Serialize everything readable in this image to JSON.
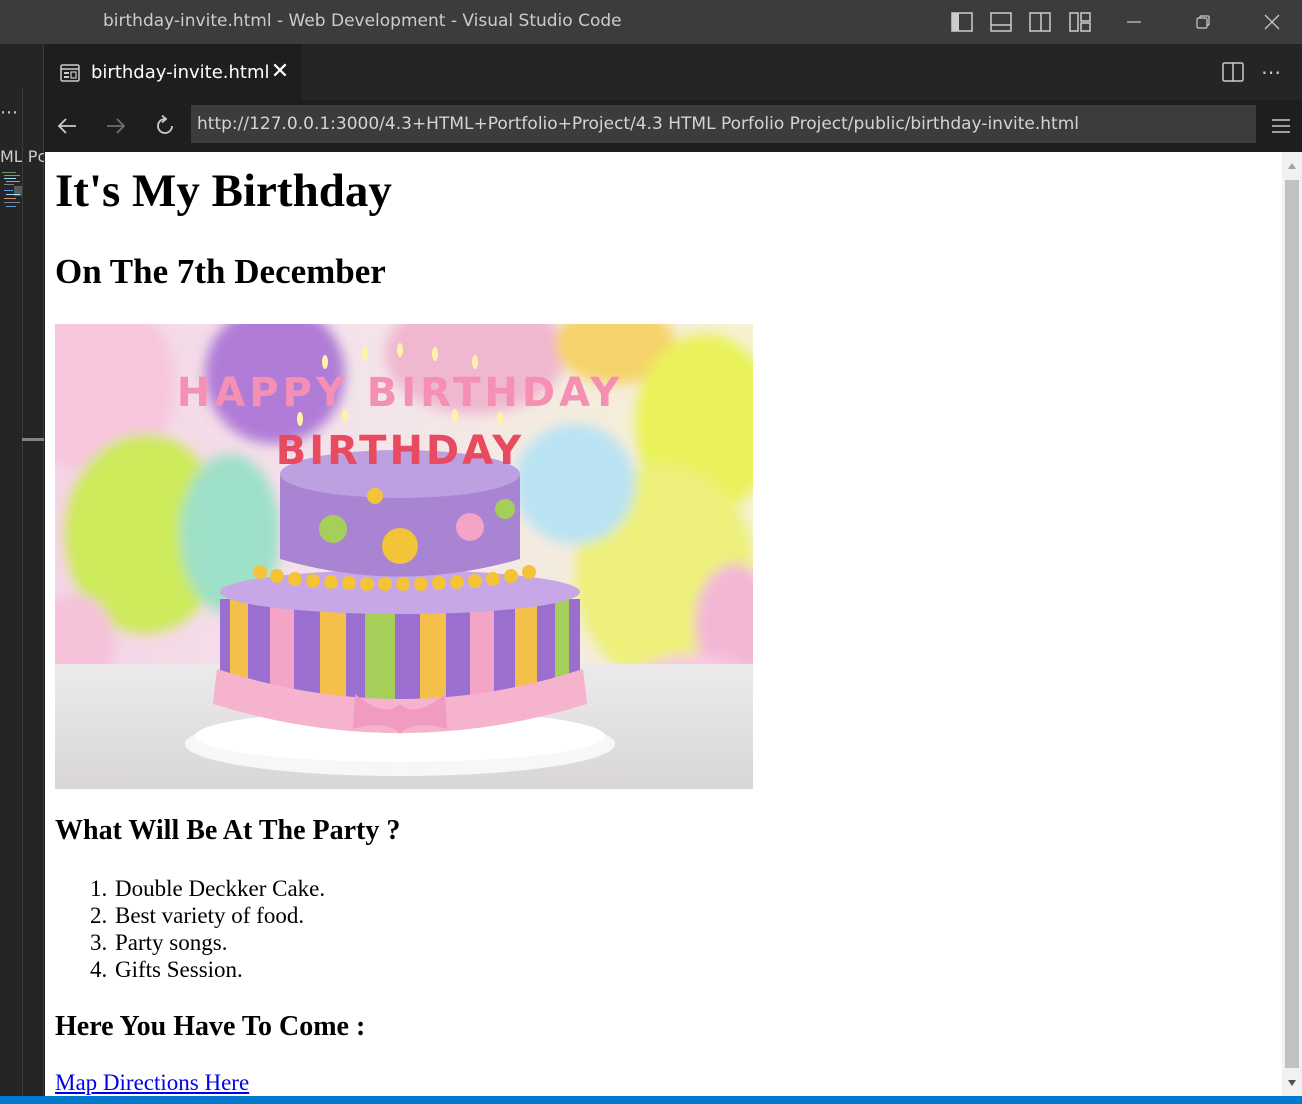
{
  "window": {
    "title": "birthday-invite.html - Web Development - Visual Studio Code"
  },
  "sidebar": {
    "label": "ML Pc"
  },
  "tab": {
    "label": "birthday-invite.html"
  },
  "browser": {
    "url": "http://127.0.0.1:3000/4.3+HTML+Portfolio+Project/4.3 HTML Porfolio Project/public/birthday-invite.html"
  },
  "page": {
    "heading": "It's My Birthday",
    "subheading": "On The 7th December",
    "image_text": "HAPPY BIRTHDAY",
    "party_heading": "What Will Be At The Party ?",
    "party_items": [
      {
        "num": "1.",
        "text": "Double Deckker Cake."
      },
      {
        "num": "2.",
        "text": "Best variety of food."
      },
      {
        "num": "3.",
        "text": "Party songs."
      },
      {
        "num": "4.",
        "text": "Gifts Session."
      }
    ],
    "come_heading": "Here You Have To Come :",
    "map_link": "Map Directions Here"
  },
  "colors": {
    "titlebar": "#3c3c3c",
    "editor_bg": "#1e1e1e",
    "statusbar": "#007acc",
    "link": "#0000ee"
  }
}
